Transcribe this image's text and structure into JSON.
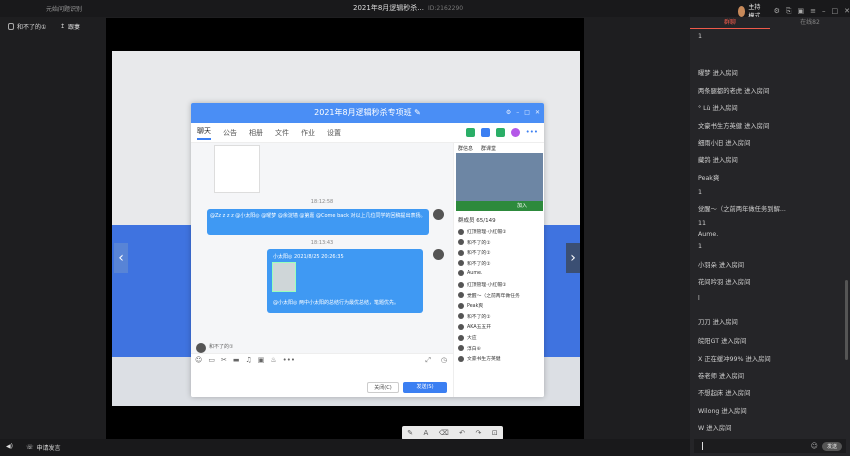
{
  "topbar": {
    "left_title": "元始问题识别",
    "title": "2021年8月逻辑秒杀...",
    "meeting_id": "ID:2162290",
    "host_label": "主持模式"
  },
  "local": {
    "name": "和不了的①",
    "follow": "跟妻"
  },
  "chat_window": {
    "title": "2021年8月逻辑秒杀专项班",
    "tabs": [
      "聊天",
      "公告",
      "相册",
      "文件",
      "作业",
      "设置"
    ],
    "time1": "18:12:58",
    "msg1": "@Zz z z z @小太阳◎ @曜梦 @余淀墙 @第嘉 @Come back 对以上几位同学的回稿提出表扬。",
    "time2": "18:13:43",
    "reply_name": "小太阳◎ 2021/8/25 20:26:35",
    "reply_text": "@小太阳◎ 两中小太阳的总结行为最优总结，笔题优先。",
    "input_user": "和不了的①",
    "close_btn": "关闭(C)",
    "send_btn": "发送(S)",
    "side_tabs": [
      "群信息",
      "群课堂"
    ],
    "join": "加入",
    "member_count": "群成员 65/149",
    "members": [
      "红顶管理·小红帽①",
      "和不了的①",
      "和不了的①",
      "和不了的①",
      "Aume.",
      "红顶管理·小红帽①",
      "觉醒～（之前两年做任务",
      "Peak爽",
      "和不了的①",
      "AKA五五开",
      "大应",
      "浮白⑥",
      "文豪书生方英健"
    ]
  },
  "sidebar": {
    "tabs": [
      "群聊",
      "在线82"
    ],
    "items": [
      {
        "text": "1"
      },
      {
        "text": "曜梦 进入房间"
      },
      {
        "text": "两条腿都的老虎 进入房间"
      },
      {
        "text": "°     Lù 进入房间"
      },
      {
        "text": "文豪书生方英健 进入房间"
      },
      {
        "text": "细雨小旧 进入房间"
      },
      {
        "text": "藏鸽 进入房间"
      },
      {
        "text": "Peak爽"
      },
      {
        "text": "1"
      },
      {
        "text": "觉醒～（之前两年做任务到解..."
      },
      {
        "text": "11"
      },
      {
        "text": "Aume."
      },
      {
        "text": "1"
      },
      {
        "text": "小羽朵 进入房间"
      },
      {
        "text": "花间吟羽 进入房间"
      },
      {
        "text": "l"
      },
      {
        "text": "刀刀 进入房间"
      },
      {
        "text": "皖阳GT 进入房间"
      },
      {
        "text": "X 正在缓冲99% 进入房间"
      },
      {
        "text": "卷老师 进入房间"
      },
      {
        "text": "不想起床 进入房间"
      },
      {
        "text": "Wilong 进入房间"
      },
      {
        "text": "W 进入房间"
      }
    ],
    "send": "发送"
  },
  "bottombar": {
    "apply_label": "申请发言"
  }
}
